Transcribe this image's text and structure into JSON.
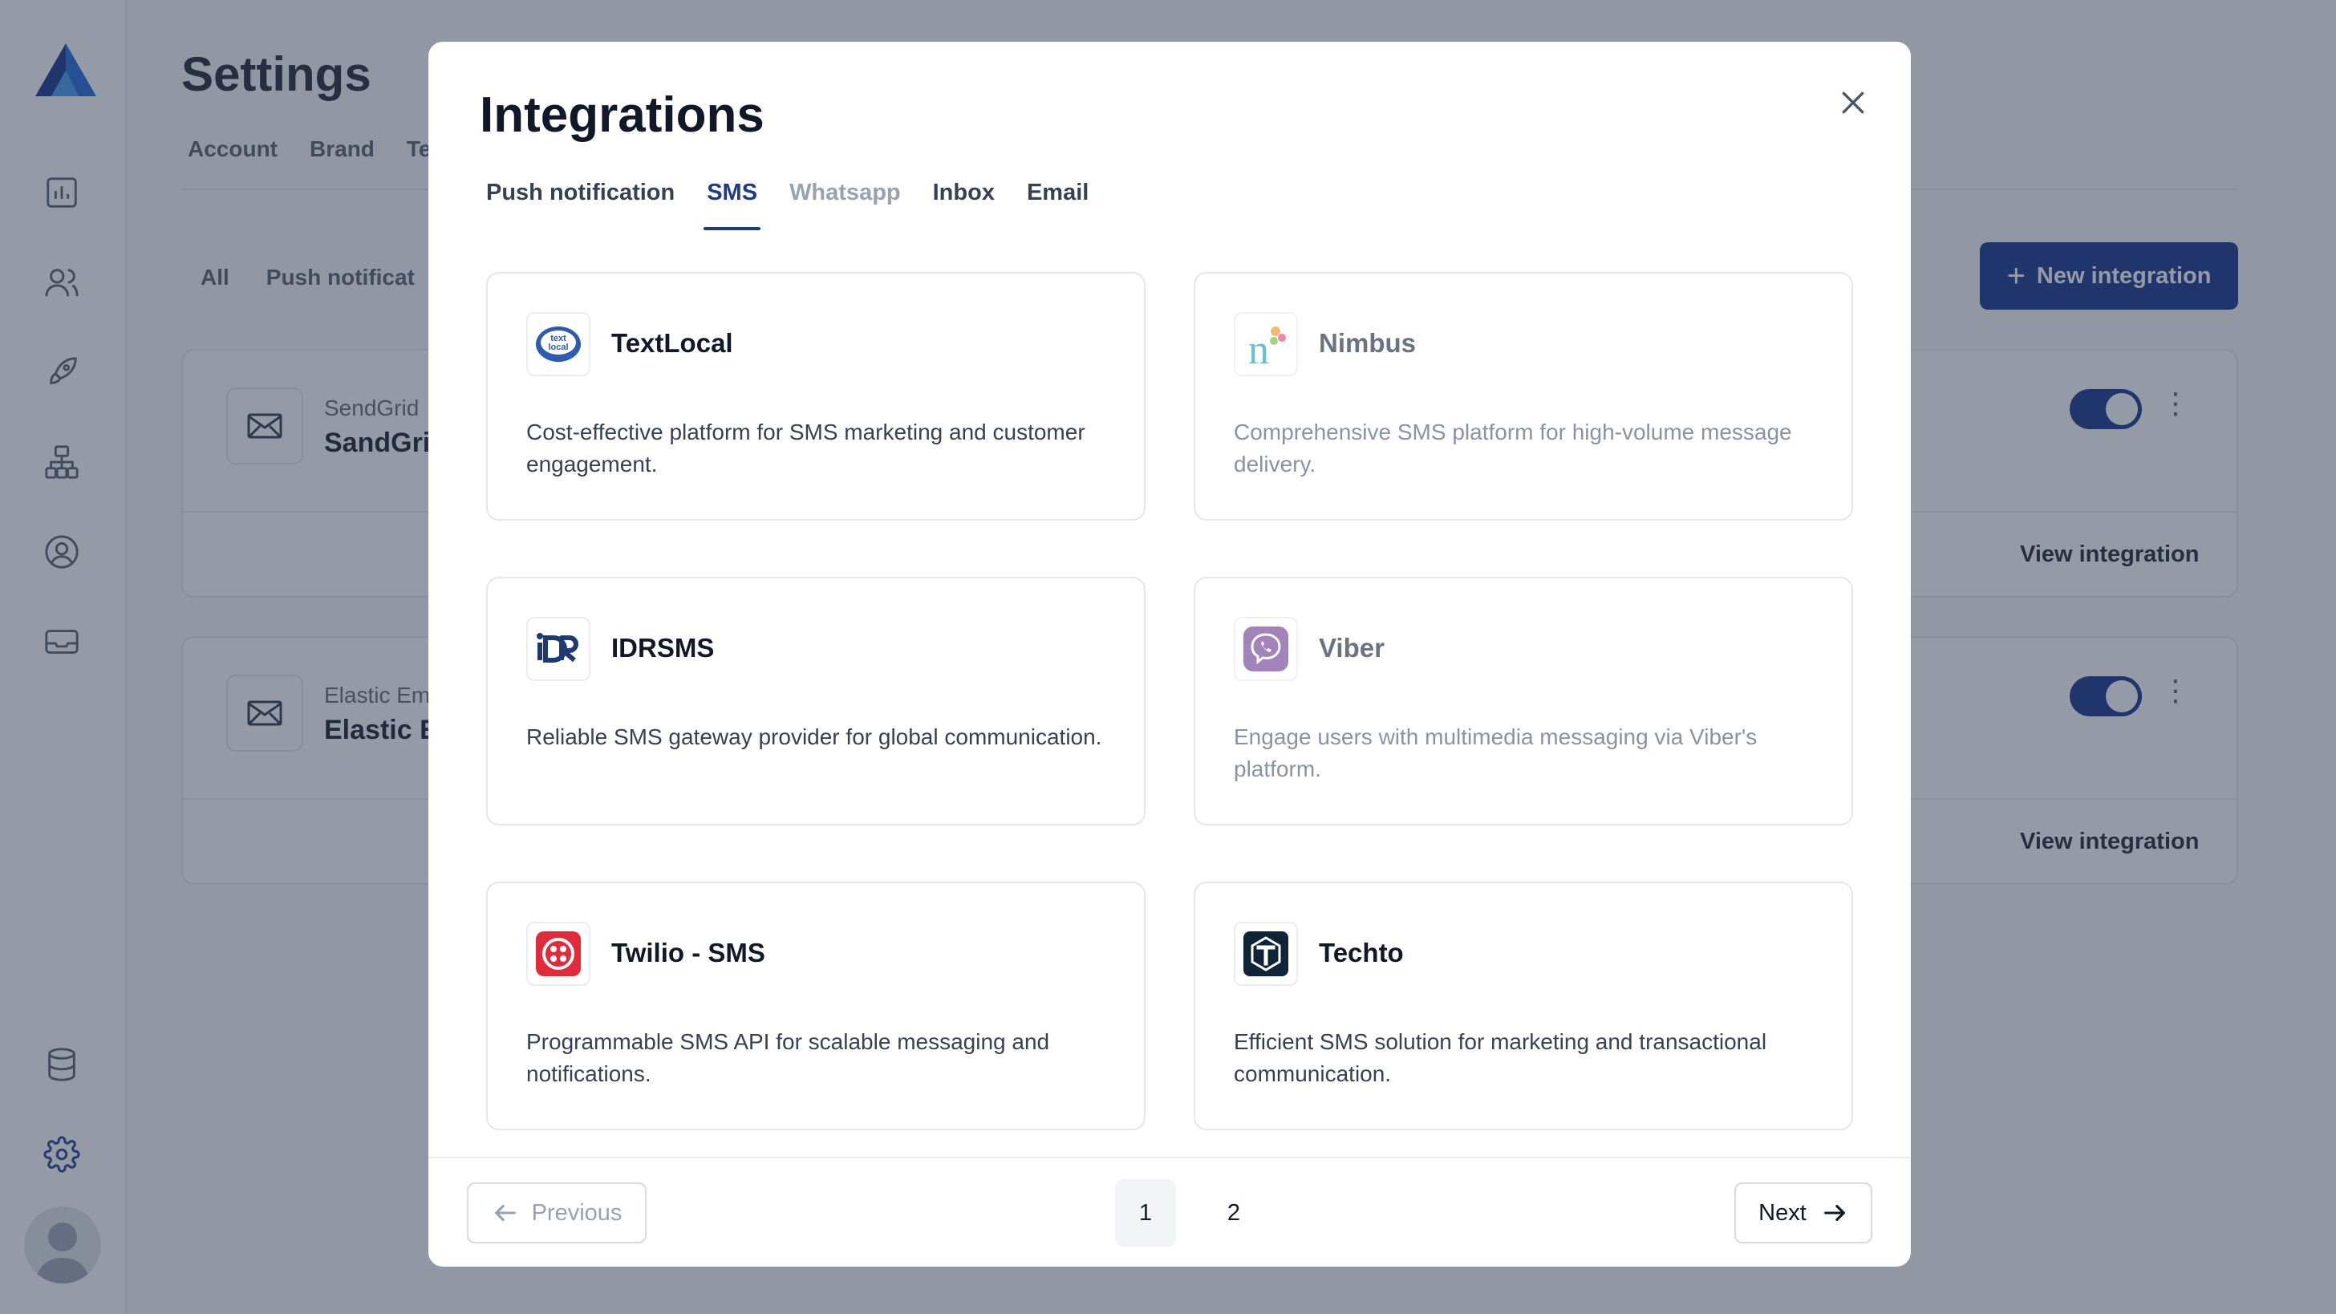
{
  "background": {
    "title": "Settings",
    "tabs": [
      "Account",
      "Brand",
      "Te"
    ],
    "filters": [
      "All",
      "Push notificat"
    ],
    "new_integration_label": "New integration",
    "cards": [
      {
        "sub": "SendGrid",
        "name": "SandGri",
        "view_label": "View integration",
        "enabled": true
      },
      {
        "sub": "Elastic Em",
        "name": "Elastic E",
        "view_label": "View integration",
        "enabled": true
      }
    ]
  },
  "modal": {
    "title": "Integrations",
    "tabs": [
      {
        "label": "Push notification",
        "state": "normal"
      },
      {
        "label": "SMS",
        "state": "active"
      },
      {
        "label": "Whatsapp",
        "state": "muted"
      },
      {
        "label": "Inbox",
        "state": "normal"
      },
      {
        "label": "Email",
        "state": "normal"
      }
    ],
    "integrations": [
      {
        "name": "TextLocal",
        "logo_text": "text local",
        "description": "Cost-effective platform for SMS marketing and customer engagement.",
        "enabled": true
      },
      {
        "name": "Nimbus",
        "logo_text": "n",
        "description": "Comprehensive SMS platform for high-volume message delivery.",
        "enabled": false
      },
      {
        "name": "IDRSMS",
        "logo_text": "iDR",
        "description": "Reliable SMS gateway provider for global communication.",
        "enabled": true
      },
      {
        "name": "Viber",
        "logo_text": "",
        "description": "Engage users with multimedia messaging via Viber's platform.",
        "enabled": false
      },
      {
        "name": "Twilio - SMS",
        "logo_text": "",
        "description": "Programmable SMS API for scalable messaging and notifications.",
        "enabled": true
      },
      {
        "name": "Techto",
        "logo_text": "T",
        "description": "Efficient SMS solution for marketing and transactional communication.",
        "enabled": true
      }
    ],
    "pagination": {
      "previous_label": "Previous",
      "next_label": "Next",
      "pages": [
        "1",
        "2"
      ],
      "current_page": "1"
    }
  },
  "colors": {
    "primary": "#1e3a8a",
    "twilio": "#e22b3a",
    "viber": "#7b519d",
    "techto": "#0f2537",
    "textlocal": "#2d5bb0"
  }
}
